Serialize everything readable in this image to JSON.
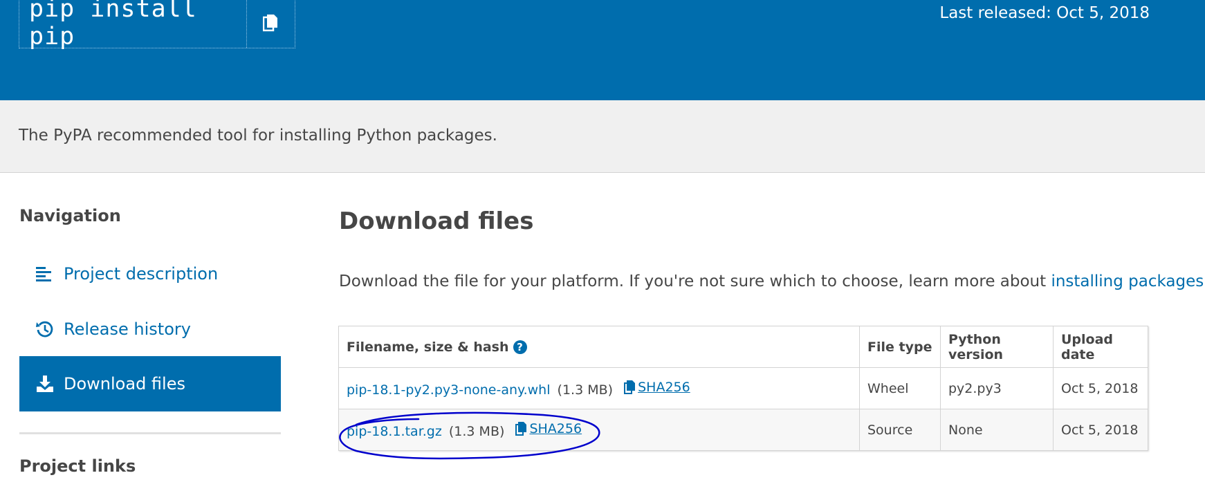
{
  "header": {
    "pip_command": "pip install pip",
    "last_released": "Last released: Oct 5, 2018"
  },
  "summary": "The PyPA recommended tool for installing Python packages.",
  "nav": {
    "heading": "Navigation",
    "items": [
      {
        "label": "Project description",
        "icon": "align-left-icon"
      },
      {
        "label": "Release history",
        "icon": "history-icon"
      },
      {
        "label": "Download files",
        "icon": "download-icon",
        "active": true
      }
    ],
    "project_links_heading": "Project links"
  },
  "download": {
    "title": "Download files",
    "intro_text": "Download the file for your platform. If you're not sure which to choose, learn more about ",
    "intro_link": "installing packages",
    "intro_end": ".",
    "table": {
      "headers": [
        "Filename, size & hash",
        "File type",
        "Python version",
        "Upload date"
      ],
      "rows": [
        {
          "filename": "pip-18.1-py2.py3-none-any.whl",
          "size": "(1.3 MB)",
          "hash": "SHA256",
          "type": "Wheel",
          "python": "py2.py3",
          "date": "Oct 5, 2018"
        },
        {
          "filename": "pip-18.1.tar.gz",
          "size": "(1.3 MB)",
          "hash": "SHA256",
          "type": "Source",
          "python": "None",
          "date": "Oct 5, 2018"
        }
      ]
    }
  },
  "colors": {
    "brand_blue": "#006dad",
    "annotation": "#0000cc"
  }
}
